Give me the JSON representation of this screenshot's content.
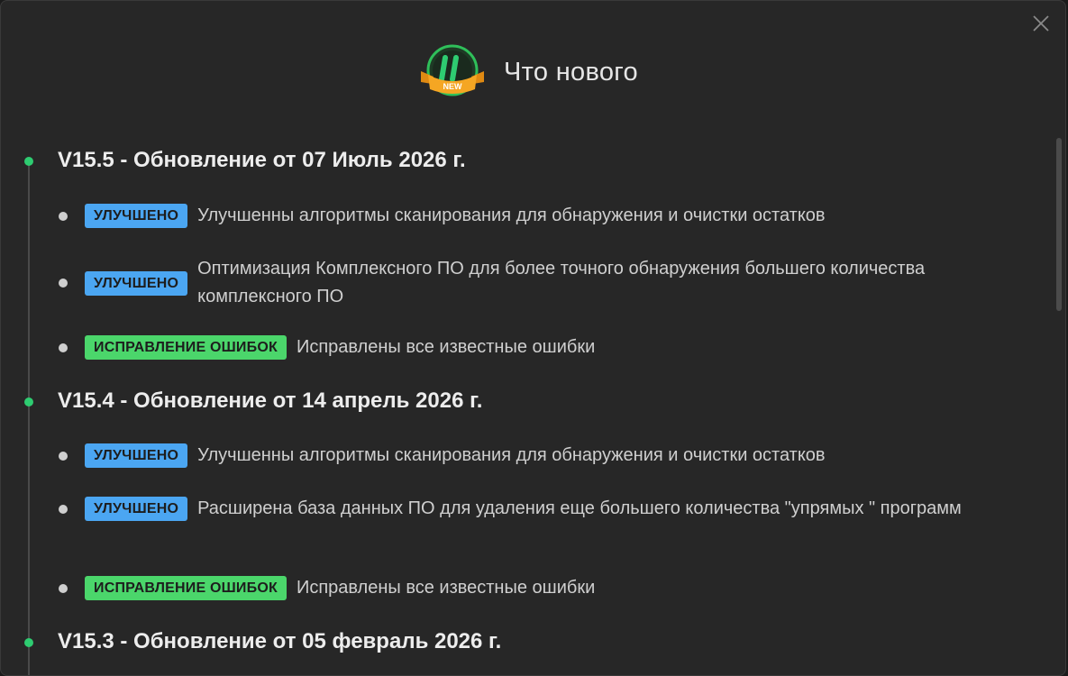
{
  "window": {
    "title": "Что нового",
    "logo_badge_text": "NEW"
  },
  "versions": [
    {
      "title": "V15.5 - Обновление от 07 Июль 2026 г.",
      "items": [
        {
          "badge": "УЛУЧШЕНО",
          "type": "improved",
          "text": "Улучшенны алгоритмы сканирования для обнаружения и очистки остатков"
        },
        {
          "badge": "УЛУЧШЕНО",
          "type": "improved",
          "text": "Оптимизация Комплексного ПО для более точного обнаружения большего количества комплексного ПО"
        },
        {
          "badge": "ИСПРАВЛЕНИЕ ОШИБОК",
          "type": "bugfix",
          "text": "Исправлены все известные ошибки"
        }
      ]
    },
    {
      "title": "V15.4 - Обновление от 14 апрель 2026 г.",
      "items": [
        {
          "badge": "УЛУЧШЕНО",
          "type": "improved",
          "text": "Улучшенны алгоритмы сканирования для обнаружения и очистки остатков"
        },
        {
          "badge": "УЛУЧШЕНО",
          "type": "improved",
          "text": "Расширена база данных ПО для удаления еще большего количества \"упрямых \" программ"
        },
        {
          "badge": "ИСПРАВЛЕНИЕ ОШИБОК",
          "type": "bugfix",
          "text": "Исправлены все известные ошибки"
        }
      ]
    },
    {
      "title": "V15.3 - Обновление от 05 февраль 2026 г.",
      "items": []
    }
  ],
  "colors": {
    "background": "#272727",
    "accent_green": "#2ecc71",
    "badge_improved": "#4ba6f2",
    "badge_bugfix": "#4bd66b"
  },
  "icons": {
    "close": "close-icon",
    "logo": "new-update-logo-icon"
  }
}
